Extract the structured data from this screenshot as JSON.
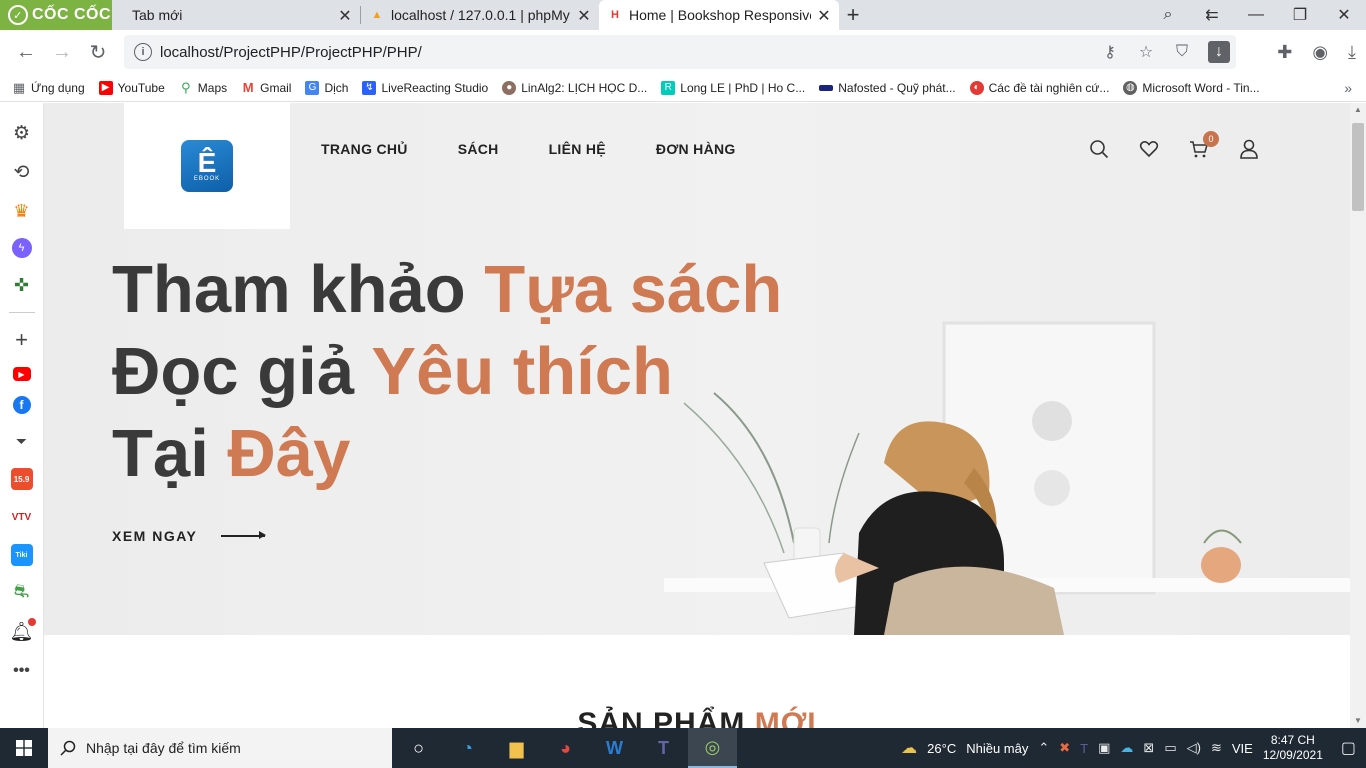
{
  "browser": {
    "brand": "CỐC CỐC",
    "tabs": [
      {
        "title": "Tab mới",
        "favicon": "none",
        "active": false
      },
      {
        "title": "localhost / 127.0.0.1 | phpMy",
        "favicon": "pma",
        "active": false
      },
      {
        "title": "Home | Bookshop Responsive",
        "favicon": "H",
        "active": true
      }
    ],
    "url": "localhost/ProjectPHP/ProjectPHP/PHP/",
    "bookmarks": [
      {
        "label": "Ứng dụng",
        "icon": "apps-grid",
        "color": "#5f6368"
      },
      {
        "label": "YouTube",
        "icon": "youtube",
        "color": "#ff0000"
      },
      {
        "label": "Maps",
        "icon": "maps-pin",
        "color": "#34a853"
      },
      {
        "label": "Gmail",
        "icon": "gmail",
        "color": "#ea4335"
      },
      {
        "label": "Dịch",
        "icon": "translate",
        "color": "#4285f4"
      },
      {
        "label": "LiveReacting Studio",
        "icon": "livereacting",
        "color": "#2962ff"
      },
      {
        "label": "LinAlg2: LỊCH HỌC D...",
        "icon": "avatar",
        "color": "#8d6e63"
      },
      {
        "label": "Long LE | PhD | Ho C...",
        "icon": "researchgate",
        "color": "#00ccbb"
      },
      {
        "label": "Nafosted - Quỹ phát...",
        "icon": "nafosted",
        "color": "#1a237e"
      },
      {
        "label": "Các đề tài nghiên cứ...",
        "icon": "globe",
        "color": "#e53935"
      },
      {
        "label": "Microsoft Word - Tin...",
        "icon": "globe-gray",
        "color": "#616161"
      }
    ]
  },
  "sidebar": {
    "items": [
      {
        "name": "settings",
        "icon": "gear-icon",
        "color": "#444"
      },
      {
        "name": "history",
        "icon": "history-icon",
        "color": "#444"
      },
      {
        "name": "crown",
        "icon": "crown-icon",
        "color": "#f57c00"
      },
      {
        "name": "messenger",
        "icon": "messenger-icon",
        "color": "#7b61ff"
      },
      {
        "name": "games",
        "icon": "gamepad-icon",
        "color": "#2e7d32"
      },
      {
        "name": "add",
        "icon": "plus-icon",
        "color": "#444"
      },
      {
        "name": "youtube",
        "icon": "youtube-icon",
        "color": "#ff0000"
      },
      {
        "name": "facebook",
        "icon": "facebook-icon",
        "color": "#1877f2"
      },
      {
        "name": "download",
        "icon": "download-icon",
        "color": "#444"
      },
      {
        "name": "shopee",
        "icon": "shopee-icon",
        "color": "#ee4d2d"
      },
      {
        "name": "vtv",
        "icon": "vtv-icon",
        "color": "#c62828"
      },
      {
        "name": "tiki",
        "icon": "tiki-icon",
        "color": "#1a94ff"
      },
      {
        "name": "game2",
        "icon": "controller-icon",
        "color": "#43a047"
      },
      {
        "name": "notifications",
        "icon": "bell-icon",
        "color": "#222"
      },
      {
        "name": "more",
        "icon": "more-icon",
        "color": "#444"
      }
    ]
  },
  "site": {
    "logo_text": "EBOOK",
    "nav": [
      "TRANG CHỦ",
      "SÁCH",
      "LIÊN HỆ",
      "ĐƠN HÀNG"
    ],
    "cart_count": "0",
    "hero": {
      "line1_a": "Tham khảo ",
      "line1_b": "Tựa sách",
      "line2_a": "Đọc giả ",
      "line2_b": "Yêu thích",
      "line3_a": "Tại ",
      "line3_b": "Đây",
      "cta": "XEM NGAY"
    },
    "section_title_a": "SẢN PHẨM ",
    "section_title_b": "MỚI",
    "accent_color": "#cf7a53"
  },
  "taskbar": {
    "search_placeholder": "Nhập tại đây để tìm kiếm",
    "weather_temp": "26°C",
    "weather_text": "Nhiều mây",
    "language": "VIE",
    "time": "8:47 CH",
    "date": "12/09/2021"
  }
}
